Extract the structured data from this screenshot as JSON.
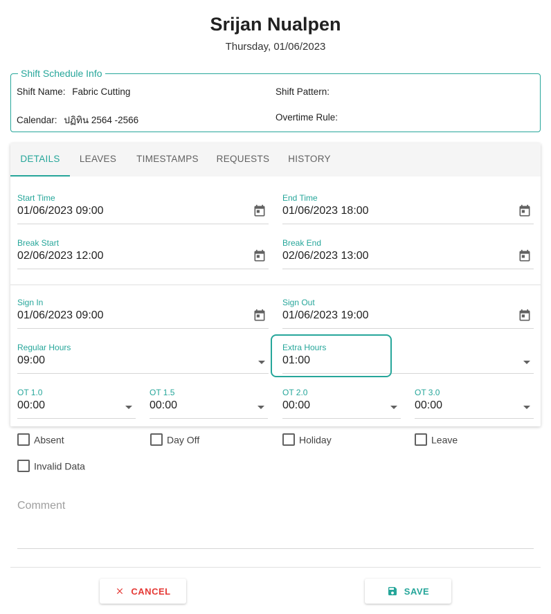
{
  "header": {
    "name": "Srijan Nualpen",
    "date": "Thursday, 01/06/2023"
  },
  "shift_info": {
    "legend": "Shift Schedule Info",
    "shift_name_label": "Shift Name:",
    "shift_name_value": "Fabric Cutting",
    "shift_pattern_label": "Shift Pattern:",
    "shift_pattern_value": "",
    "calendar_label": "Calendar:",
    "calendar_value": "ปฏิทิน 2564 -2566",
    "overtime_rule_label": "Overtime Rule:",
    "overtime_rule_value": ""
  },
  "tabs": [
    {
      "label": "DETAILS",
      "active": true
    },
    {
      "label": "LEAVES",
      "active": false
    },
    {
      "label": "TIMESTAMPS",
      "active": false
    },
    {
      "label": "REQUESTS",
      "active": false
    },
    {
      "label": "HISTORY",
      "active": false
    }
  ],
  "schedule": {
    "start_time": {
      "label": "Start Time",
      "value": "01/06/2023 09:00"
    },
    "end_time": {
      "label": "End Time",
      "value": "01/06/2023 18:00"
    },
    "break_start": {
      "label": "Break Start",
      "value": "02/06/2023 12:00"
    },
    "break_end": {
      "label": "Break End",
      "value": "02/06/2023 13:00"
    }
  },
  "actual": {
    "sign_in": {
      "label": "Sign In",
      "value": "01/06/2023 09:00"
    },
    "sign_out": {
      "label": "Sign Out",
      "value": "01/06/2023 19:00"
    },
    "regular_hours": {
      "label": "Regular Hours",
      "value": "09:00"
    },
    "extra_hours": {
      "label": "Extra Hours",
      "value": "01:00"
    }
  },
  "overtime": [
    {
      "label": "OT 1.0",
      "value": "00:00"
    },
    {
      "label": "OT 1.5",
      "value": "00:00"
    },
    {
      "label": "OT 2.0",
      "value": "00:00"
    },
    {
      "label": "OT 3.0",
      "value": "00:00"
    }
  ],
  "checkboxes": [
    {
      "label": "Absent",
      "checked": false
    },
    {
      "label": "Day Off",
      "checked": false
    },
    {
      "label": "Holiday",
      "checked": false
    },
    {
      "label": "Leave",
      "checked": false
    },
    {
      "label": "Invalid Data",
      "checked": false
    }
  ],
  "comment": {
    "placeholder": "Comment"
  },
  "buttons": {
    "cancel": "CANCEL",
    "save": "SAVE"
  },
  "colors": {
    "accent": "#26a69a",
    "danger": "#e53935"
  },
  "icons": {
    "date_picker": "calendar-icon",
    "dropdown": "caret-down-icon",
    "cancel": "close-icon",
    "save": "floppy-disk-icon"
  }
}
